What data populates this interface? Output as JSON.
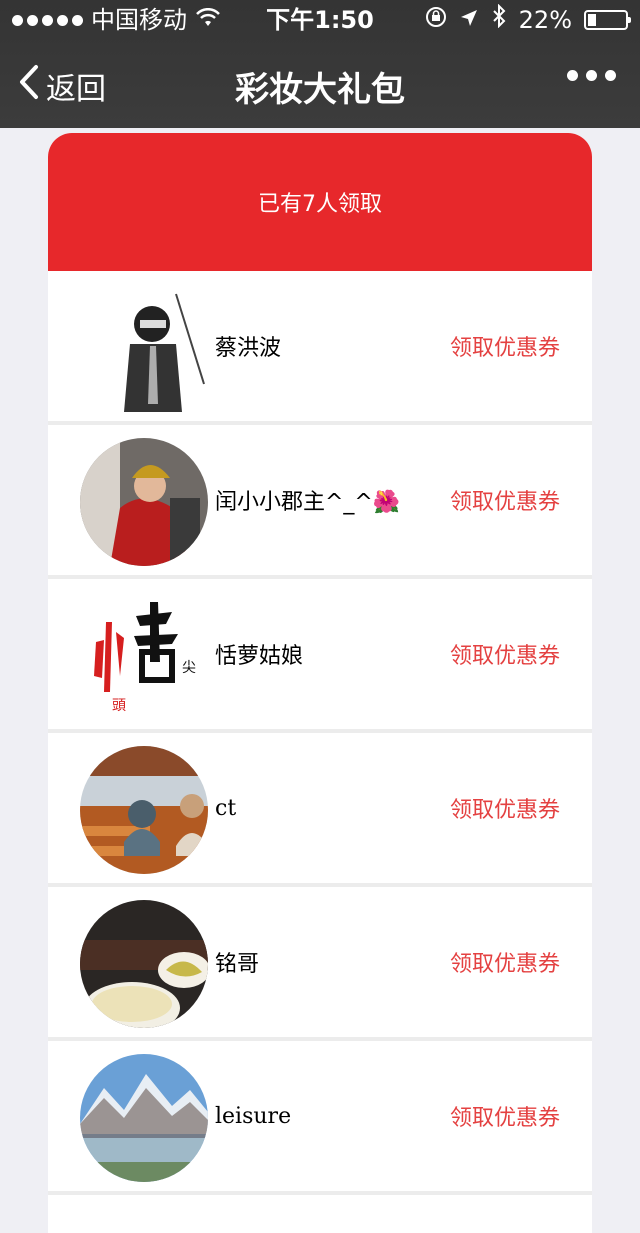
{
  "status": {
    "carrier": "中国移动",
    "time": "下午1:50",
    "battery_text": "22%",
    "battery_level": 0.22
  },
  "nav": {
    "back_label": "返回",
    "title": "彩妆大礼包"
  },
  "card": {
    "header_text": "已有7人领取",
    "coupon_label": "领取优惠券",
    "items": [
      {
        "name": "蔡洪波"
      },
      {
        "name": "闰小小郡主^_^🌺"
      },
      {
        "name": "恬萝姑娘"
      },
      {
        "name": "ct"
      },
      {
        "name": "铭哥"
      },
      {
        "name": "leisure"
      }
    ]
  },
  "colors": {
    "accent": "#e7282b",
    "coupon_text": "#e44141"
  }
}
